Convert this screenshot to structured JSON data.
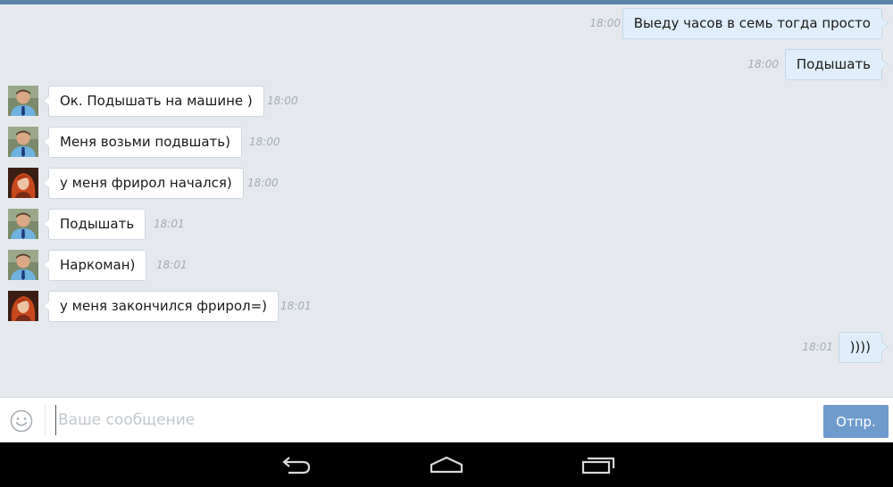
{
  "conversation": {
    "messages": [
      {
        "direction": "out",
        "text": "Выеду часов в семь тогда просто",
        "time": "18:00"
      },
      {
        "direction": "out",
        "text": "Подышать",
        "time": "18:00"
      },
      {
        "direction": "in",
        "avatar": "avatar-man-tie",
        "text": "Ок. Подышать на машине )",
        "time": "18:00"
      },
      {
        "direction": "in",
        "avatar": "avatar-man-tie",
        "text": "Меня возьми подвшать)",
        "time": "18:00"
      },
      {
        "direction": "in",
        "avatar": "avatar-redhead",
        "text": "у меня фрирол начался)",
        "time": "18:00"
      },
      {
        "direction": "in",
        "avatar": "avatar-man-tie",
        "text": "Подышать",
        "time": "18:01"
      },
      {
        "direction": "in",
        "avatar": "avatar-man-tie",
        "text": "Наркоман)",
        "time": "18:01"
      },
      {
        "direction": "in",
        "avatar": "avatar-redhead",
        "text": "у меня закончился фрирол=)",
        "time": "18:01"
      },
      {
        "direction": "out",
        "text": "))))",
        "time": "18:01"
      }
    ]
  },
  "composer": {
    "placeholder": "Ваше сообщение",
    "value": "",
    "send_label": "Отпр.",
    "emoji_icon": "smiley-icon"
  },
  "navigation": {
    "icons": [
      "back-icon",
      "home-icon",
      "recent-apps-icon"
    ]
  },
  "colors": {
    "background": "#e5e9ee",
    "outgoing_bubble": "#dfeefa",
    "incoming_bubble": "#ffffff",
    "send_button": "#6f9bcc",
    "timestamp": "#a3acb6"
  }
}
